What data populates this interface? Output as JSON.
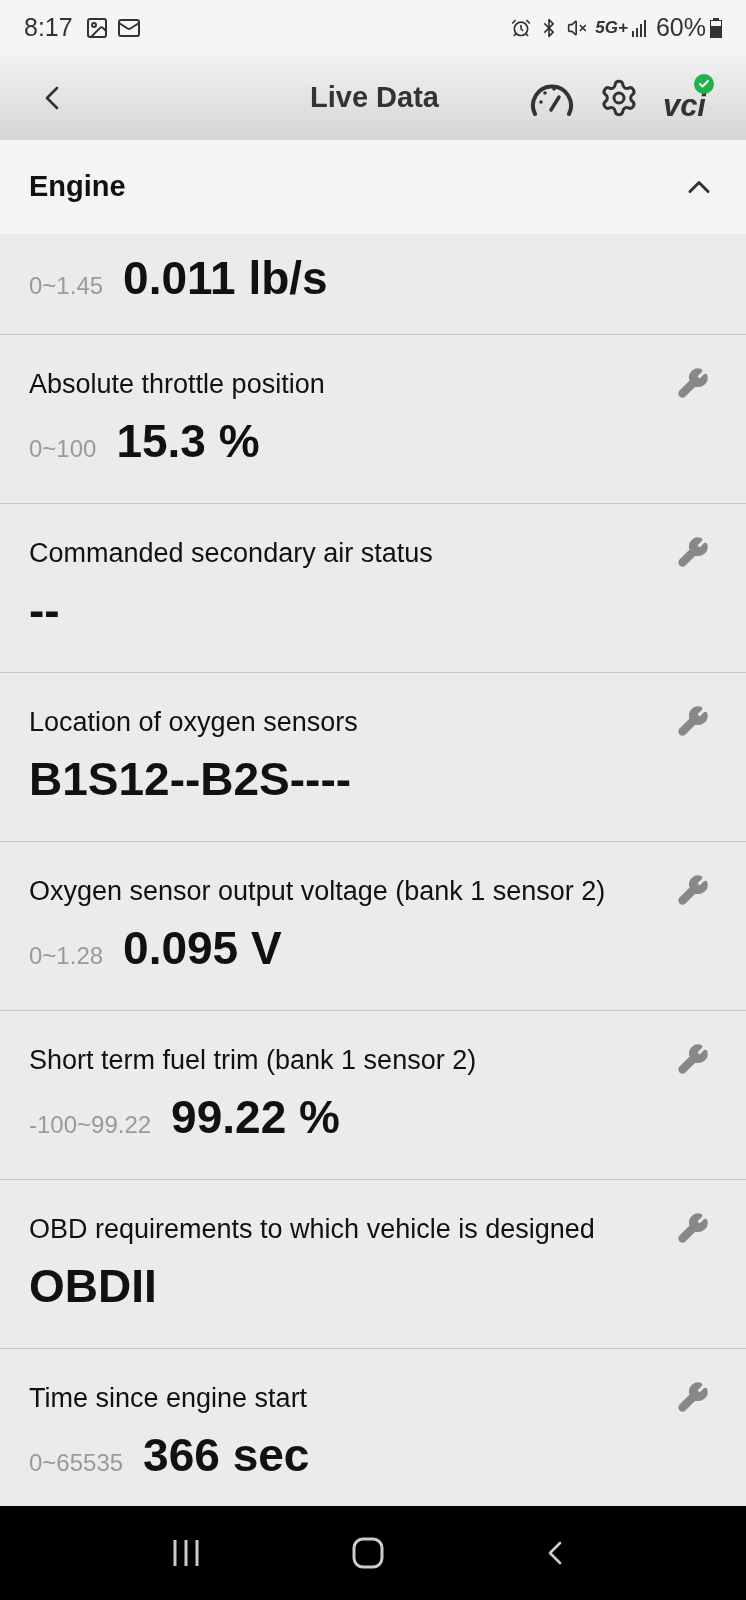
{
  "status_bar": {
    "time": "8:17",
    "network": "5G+",
    "battery": "60%"
  },
  "header": {
    "title": "Live Data",
    "vci_label": "vci",
    "vci_connected": true
  },
  "section": {
    "title": "Engine",
    "expanded": true
  },
  "items": [
    {
      "value": "0.011 lb/s",
      "range": "0~1.45"
    },
    {
      "label": "Absolute throttle position",
      "value": "15.3 %",
      "range": "0~100"
    },
    {
      "label": "Commanded secondary air status",
      "value": "--"
    },
    {
      "label": "Location of oxygen sensors",
      "value": "B1S12--B2S----"
    },
    {
      "label": "Oxygen sensor output voltage (bank 1 sensor 2)",
      "value": "0.095 V",
      "range": "0~1.28"
    },
    {
      "label": "Short term fuel trim (bank 1 sensor 2)",
      "value": "99.22 %",
      "range": "-100~99.22"
    },
    {
      "label": "OBD requirements to which vehicle is designed",
      "value": "OBDII"
    },
    {
      "label": "Time since engine start",
      "value": "366 sec",
      "range": "0~65535"
    }
  ]
}
